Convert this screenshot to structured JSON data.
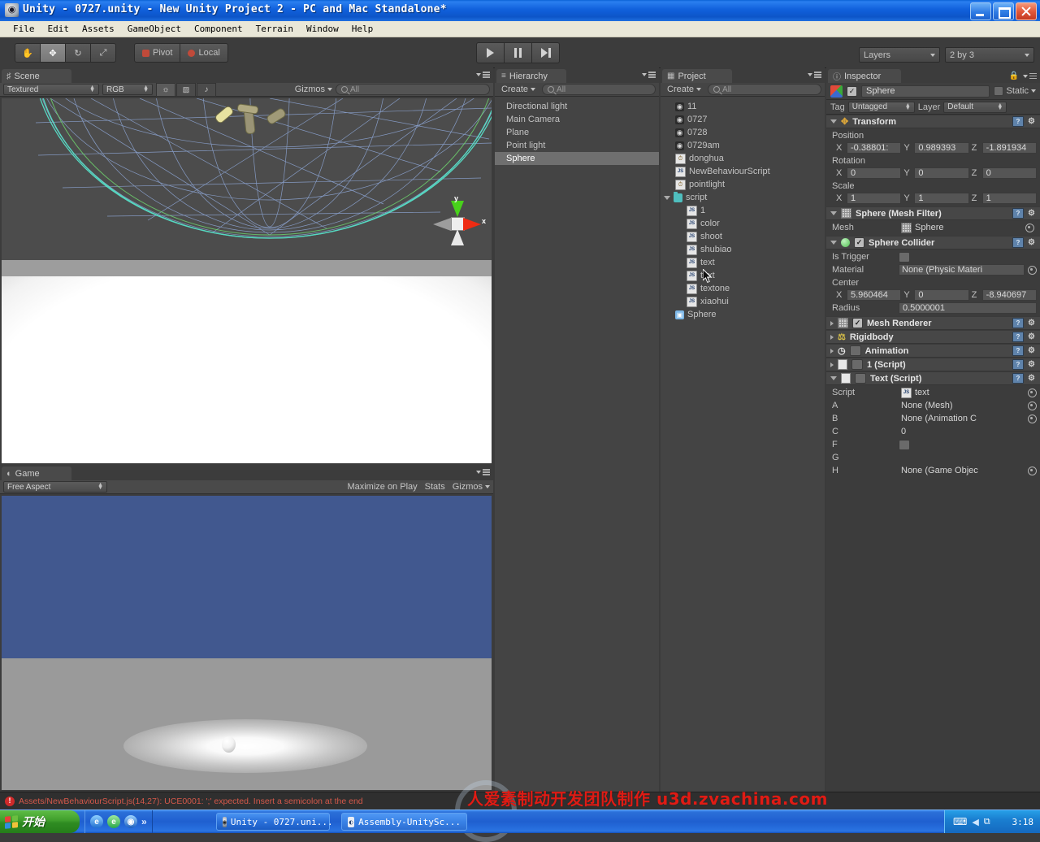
{
  "window": {
    "title": "Unity - 0727.unity - New Unity Project 2 - PC and Mac Standalone*",
    "icon": "unity-icon",
    "minimize": "–",
    "maximize": "□",
    "close": "✕"
  },
  "menu": {
    "items": [
      "File",
      "Edit",
      "Assets",
      "GameObject",
      "Component",
      "Terrain",
      "Window",
      "Help"
    ]
  },
  "toolbar": {
    "tools": [
      {
        "name": "hand-tool",
        "glyph": "✋",
        "active": false
      },
      {
        "name": "move-tool",
        "glyph": "✥",
        "active": true
      },
      {
        "name": "rotate-tool",
        "glyph": "↻",
        "active": false
      },
      {
        "name": "scale-tool",
        "glyph": "⤢",
        "active": false
      }
    ],
    "pivot_label": "Pivot",
    "local_label": "Local",
    "play_label": "▶",
    "pause_label": "‖",
    "step_label": "▶|",
    "layers_label": "Layers",
    "layout_label": "2 by 3"
  },
  "scene": {
    "tab": "Scene",
    "draw_mode": "Textured",
    "render_mode": "RGB",
    "lighting_icon": "sun-icon",
    "fx_icon": "image-icon",
    "audio_icon": "audio-icon",
    "gizmos_label": "Gizmos",
    "search_placeholder": "All",
    "gizmo_axes": {
      "y": "y",
      "x": "x"
    }
  },
  "game": {
    "tab": "Game",
    "aspect": "Free Aspect",
    "maximize_label": "Maximize on Play",
    "stats_label": "Stats",
    "gizmos_label": "Gizmos"
  },
  "hierarchy": {
    "tab": "Hierarchy",
    "create_label": "Create",
    "search_placeholder": "All",
    "items": [
      {
        "label": "Directional light",
        "selected": false
      },
      {
        "label": "Main Camera",
        "selected": false
      },
      {
        "label": "Plane",
        "selected": false
      },
      {
        "label": "Point light",
        "selected": false
      },
      {
        "label": "Sphere",
        "selected": true
      }
    ]
  },
  "project": {
    "tab": "Project",
    "create_label": "Create",
    "search_placeholder": "All",
    "items": [
      {
        "label": "11",
        "icon": "unity-scene-icon",
        "indent": 0
      },
      {
        "label": "0727",
        "icon": "unity-scene-icon",
        "indent": 0
      },
      {
        "label": "0728",
        "icon": "unity-scene-icon",
        "indent": 0
      },
      {
        "label": "0729am",
        "icon": "unity-scene-icon",
        "indent": 0
      },
      {
        "label": "donghua",
        "icon": "animation-clip-icon",
        "indent": 0
      },
      {
        "label": "NewBehaviourScript",
        "icon": "js-script-icon",
        "indent": 0
      },
      {
        "label": "pointlight",
        "icon": "animation-clip-icon",
        "indent": 0
      },
      {
        "label": "script",
        "icon": "folder-icon",
        "indent": 0,
        "expanded": true
      },
      {
        "label": "1",
        "icon": "js-script-icon",
        "indent": 1
      },
      {
        "label": "color",
        "icon": "js-script-icon",
        "indent": 1
      },
      {
        "label": "shoot",
        "icon": "js-script-icon",
        "indent": 1
      },
      {
        "label": "shubiao",
        "icon": "js-script-icon",
        "indent": 1
      },
      {
        "label": "text",
        "icon": "js-script-icon",
        "indent": 1
      },
      {
        "label": "text",
        "icon": "js-script-icon",
        "indent": 1
      },
      {
        "label": "textone",
        "icon": "js-script-icon",
        "indent": 1
      },
      {
        "label": "xiaohui",
        "icon": "js-script-icon",
        "indent": 1
      },
      {
        "label": "Sphere",
        "icon": "prefab-icon",
        "indent": 0
      }
    ]
  },
  "inspector": {
    "tab": "Inspector",
    "lock_icon": "lock-icon",
    "object_name": "Sphere",
    "enabled": true,
    "static_label": "Static",
    "tag_label": "Tag",
    "tag_value": "Untagged",
    "layer_label": "Layer",
    "layer_value": "Default",
    "transform": {
      "title": "Transform",
      "position_label": "Position",
      "position": {
        "x": "-0.38801:",
        "y": "0.989393",
        "z": "-1.891934"
      },
      "rotation_label": "Rotation",
      "rotation": {
        "x": "0",
        "y": "0",
        "z": "0"
      },
      "scale_label": "Scale",
      "scale": {
        "x": "1",
        "y": "1",
        "z": "1"
      }
    },
    "mesh_filter": {
      "title": "Sphere (Mesh Filter)",
      "mesh_label": "Mesh",
      "mesh_value": "Sphere"
    },
    "sphere_collider": {
      "title": "Sphere Collider",
      "enabled": true,
      "is_trigger_label": "Is Trigger",
      "is_trigger": false,
      "material_label": "Material",
      "material_value": "None (Physic Materi",
      "center_label": "Center",
      "center": {
        "x": "5.960464",
        "y": "0",
        "z": "-8.940697"
      },
      "radius_label": "Radius",
      "radius_value": "0.5000001"
    },
    "components": [
      {
        "title": "Mesh Renderer",
        "icon": "mesh-renderer-icon",
        "checked": true
      },
      {
        "title": "Rigidbody",
        "icon": "rigidbody-icon",
        "checked": null
      },
      {
        "title": "Animation",
        "icon": "animation-icon",
        "checked": false
      },
      {
        "title": "1 (Script)",
        "icon": "script-icon",
        "checked": false
      }
    ],
    "text_script": {
      "title": "Text (Script)",
      "icon": "script-icon",
      "checked": false,
      "fields": [
        {
          "label": "Script",
          "value": "text",
          "type": "object",
          "icon": "js-script-icon"
        },
        {
          "label": "A",
          "value": "None (Mesh)",
          "type": "object"
        },
        {
          "label": "B",
          "value": "None (Animation C",
          "type": "object"
        },
        {
          "label": "C",
          "value": "0",
          "type": "text"
        },
        {
          "label": "F",
          "value": "",
          "type": "checkbox"
        },
        {
          "label": "G",
          "value": "",
          "type": "blank"
        },
        {
          "label": "H",
          "value": "None (Game Objec",
          "type": "object"
        }
      ]
    }
  },
  "status": {
    "error_icon": "error-icon",
    "message": "Assets/NewBehaviourScript.js(14,27): UCE0001: ';' expected. Insert a semicolon at the end"
  },
  "watermark": {
    "text": "人爱素制动开发团队制作  u3d.zvachina.com"
  },
  "taskbar": {
    "start_label": "开始",
    "quick_launch": [
      {
        "name": "ie-icon",
        "glyph": "e",
        "color": "#1f6fd0"
      },
      {
        "name": "browser-icon",
        "glyph": "e",
        "color": "#2aa84a"
      },
      {
        "name": "app-icon",
        "glyph": "◉",
        "color": "#1a5fbf"
      },
      {
        "name": "more-icon",
        "glyph": "»",
        "color": "transparent"
      }
    ],
    "tasks": [
      {
        "label": "Unity - 0727.uni...",
        "icon": "unity-icon",
        "active": true
      },
      {
        "label": "Assembly-UnitySc...",
        "icon": "script-window-icon",
        "active": false
      }
    ],
    "tray": [
      {
        "name": "keyboard-icon",
        "glyph": "⌨"
      },
      {
        "name": "arrow-icon",
        "glyph": "◀"
      },
      {
        "name": "network-icon",
        "glyph": "⬚"
      }
    ],
    "clock": "3:18"
  },
  "colors": {
    "accent_blue": "#1f5fd0",
    "panel_bg": "#3c3c3c",
    "list_bg": "#444444",
    "selection": "#6f6f6f",
    "error_red": "#d4584a",
    "watermark_red": "#e01b14"
  }
}
